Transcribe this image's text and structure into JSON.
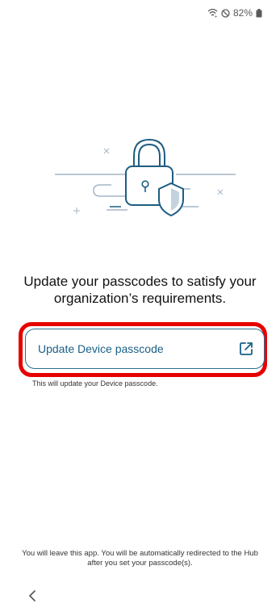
{
  "status_bar": {
    "wifi_icon": "wifi-icon",
    "dnd_icon": "do-not-disturb-icon",
    "battery_text": "82%",
    "battery_icon": "battery-icon"
  },
  "illustration": {
    "icon": "padlock-with-shield-illustration"
  },
  "headline": "Update your passcodes to satisfy your organization’s requirements.",
  "device_passcode": {
    "button_label": "Update Device passcode",
    "button_icon": "external-link-icon",
    "helper_text": "This will update your Device passcode."
  },
  "footer_note": "You will leave this app. You will be automatically redirected to the Hub after you set your passcode(s).",
  "navigation": {
    "back_icon": "chevron-left-icon"
  },
  "colors": {
    "accent": "#1a5f86",
    "highlight": "#e60000",
    "illustration_primary": "#1e5d82",
    "illustration_secondary": "#a6b6c6"
  }
}
